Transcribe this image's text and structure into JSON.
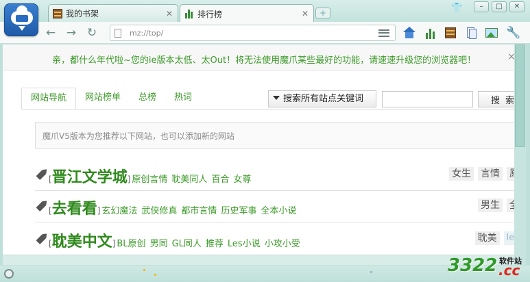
{
  "tabs": [
    {
      "label": "我的书架",
      "icon": "bookshelf-icon"
    },
    {
      "label": "排行榜",
      "icon": "bar-chart-icon"
    }
  ],
  "address": {
    "url": "mz://top/"
  },
  "notice": {
    "text": "亲，都什么年代啦~您的ie版本太低、太Out！将无法使用魔爪某些最好的功能，请速速升级您的浏览器吧！",
    "close": "×"
  },
  "nav_tabs": [
    "网站导航",
    "网站榜单",
    "总榜",
    "热词"
  ],
  "search": {
    "scope_label": "搜索所有站点关键词",
    "input_value": "",
    "button_label": "搜索"
  },
  "info_text": "魔爪V5版本为您推荐以下网站，也可以添加新的网站",
  "sites": [
    {
      "name": "晋江文学城",
      "links": [
        "原创言情",
        "耽美同人",
        "百合",
        "女尊"
      ],
      "tags": [
        "女生",
        "言情",
        "原"
      ]
    },
    {
      "name": "去看看",
      "links": [
        "玄幻魔法",
        "武侠修真",
        "都市言情",
        "历史军事",
        "全本小说"
      ],
      "tags": [
        "男生",
        "全"
      ]
    },
    {
      "name": "耽美中文",
      "links": [
        "BL原创",
        "男同",
        "GL同人",
        "推荐",
        "Les小说",
        "小攻小受"
      ],
      "tags": [
        "耽美",
        "les"
      ]
    }
  ],
  "watermark": {
    "number": "3322",
    "label": "软件站",
    "domain": ".cc"
  },
  "colors": {
    "accent_green": "#3d9b2a",
    "chrome": "#bfe0da",
    "watermark_red": "#e1261c"
  }
}
